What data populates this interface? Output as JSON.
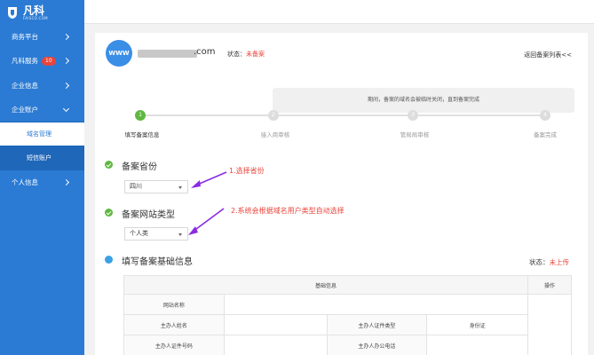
{
  "brand": {
    "name_cn": "凡科",
    "name_en": "FAISCO.COM"
  },
  "sidebar": {
    "items": [
      {
        "label": "商务平台",
        "chevron": "right"
      },
      {
        "label": "凡科服务",
        "badge": "10",
        "chevron": "right"
      },
      {
        "label": "企业信息",
        "chevron": "right"
      },
      {
        "label": "企业账户",
        "chevron": "down"
      },
      {
        "label": "个人信息",
        "chevron": "right"
      }
    ],
    "subitems": [
      {
        "label": "域名管理",
        "active": true
      },
      {
        "label": "短信账户",
        "active": false
      }
    ]
  },
  "header": {
    "www_badge": "WWW",
    "domain_suffix": ".com",
    "status_label": "状态：",
    "status_value": "未备案",
    "back_link": "返回备案列表<<"
  },
  "steps": {
    "tooltip": "期间，备案的域名会被临时关闭，直到备案完成",
    "items": [
      {
        "num": "1",
        "label": "填写备案信息",
        "active": true
      },
      {
        "num": "2",
        "label": "接入商审核",
        "active": false
      },
      {
        "num": "3",
        "label": "管局局审核",
        "active": false
      },
      {
        "num": "4",
        "label": "备案完成",
        "active": false
      }
    ]
  },
  "sections": {
    "province": {
      "title": "备案省份",
      "selected": "四川",
      "annotation": "1.选择省份"
    },
    "site_type": {
      "title": "备案网站类型",
      "selected": "个人类",
      "annotation": "2.系统会根据域名用户类型自动选择"
    },
    "basic": {
      "title": "填写备案基础信息",
      "status_label": "状态：",
      "status_value": "未上传"
    }
  },
  "table": {
    "header_main": "基础信息",
    "header_op": "操作",
    "rows": [
      {
        "label1": "网站名称"
      },
      {
        "label1": "主办人姓名",
        "label2": "主办人证件类型",
        "value2": "身份证"
      },
      {
        "label1": "主办人证件号码",
        "label2": "主办人办公电话"
      }
    ]
  },
  "colors": {
    "sidebar": "#2b7bd4",
    "accent_green": "#5fb840",
    "alert_red": "#e9443b",
    "annotation_arrow": "#8a2be2"
  }
}
